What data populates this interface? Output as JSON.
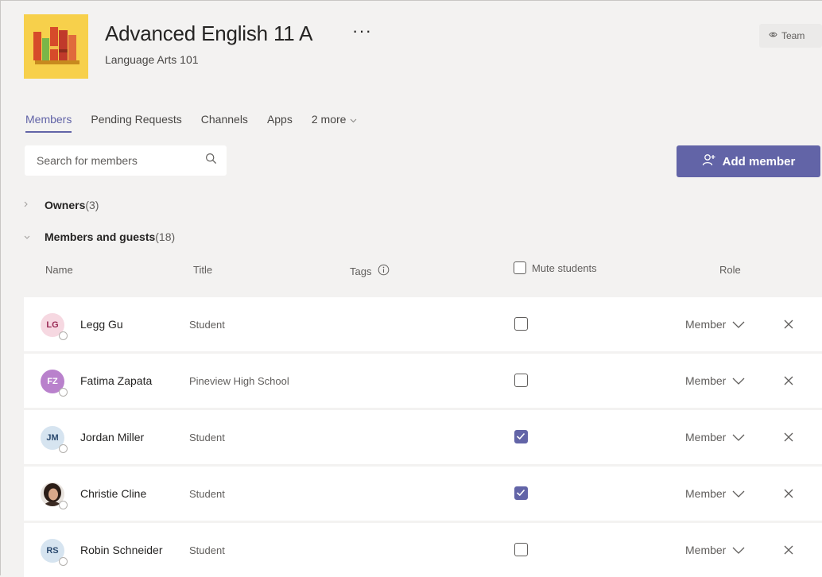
{
  "team": {
    "title": "Advanced English 11 A",
    "more_label": "···",
    "subtitle": "Language Arts 101",
    "team_button_label": "Team",
    "logo_icon": "books-icon"
  },
  "tabs": [
    {
      "label": "Members",
      "active": true
    },
    {
      "label": "Pending Requests",
      "active": false
    },
    {
      "label": "Channels",
      "active": false
    },
    {
      "label": "Apps",
      "active": false
    },
    {
      "label": "2 more",
      "active": false
    }
  ],
  "search": {
    "placeholder": "Search for members",
    "icon": "search-icon"
  },
  "add_member": {
    "label": "Add member",
    "icon": "add-person-icon"
  },
  "sections": {
    "owners": {
      "label": "Owners",
      "count": "(3)"
    },
    "members": {
      "label": "Members and guests",
      "count": "(18)"
    }
  },
  "columns": {
    "name": "Name",
    "title": "Title",
    "tags": "Tags",
    "mute": "Mute students",
    "role": "Role"
  },
  "rows": [
    {
      "initials": "LG",
      "name": "Legg Gu",
      "title": "Student",
      "muted": false,
      "role": "Member",
      "avatar_bg": "#f6d8e1",
      "avatar_fg": "#9a2a55"
    },
    {
      "initials": "FZ",
      "name": "Fatima Zapata",
      "title": "Pineview High School",
      "muted": false,
      "role": "Member",
      "avatar_bg": "#b981cc",
      "avatar_fg": "#ffffff"
    },
    {
      "initials": "JM",
      "name": "Jordan Miller",
      "title": "Student",
      "muted": true,
      "role": "Member",
      "avatar_bg": "#d6e4f0",
      "avatar_fg": "#2b4a6f"
    },
    {
      "initials": "",
      "name": "Christie Cline",
      "title": "Student",
      "muted": true,
      "role": "Member",
      "avatar_bg": "#3a2a22",
      "avatar_fg": "#ffffff",
      "photo": true
    },
    {
      "initials": "RS",
      "name": "Robin Schneider",
      "title": "Student",
      "muted": false,
      "role": "Member",
      "avatar_bg": "#d6e4f0",
      "avatar_fg": "#2b4a6f"
    }
  ],
  "colors": {
    "accent": "#6264a7",
    "logo_bg": "#f7d04b",
    "page_bg": "#f3f2f1"
  }
}
